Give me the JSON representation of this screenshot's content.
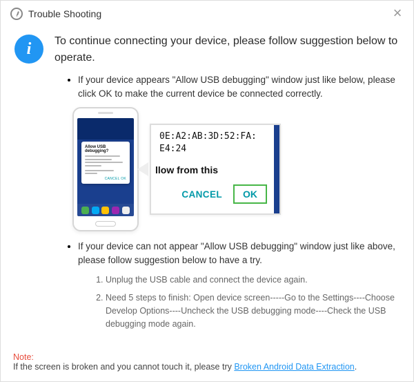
{
  "window": {
    "title": "Trouble Shooting",
    "info_glyph": "i"
  },
  "headline": "To continue connecting your device, please follow suggestion below to operate.",
  "bullet1": "If your device appears \"Allow USB debugging\" window just like below, please click OK to make the current device  be connected correctly.",
  "bullet2": "If your device can not appear \"Allow USB debugging\" window just like above, please follow suggestion below to have a try.",
  "phone_dialog": {
    "title": "Allow USB debugging?",
    "buttons": "CANCEL    OK"
  },
  "zoom": {
    "mac_line1": "0E:A2:AB:3D:52:FA:",
    "mac_line2": "E4:24",
    "allow_from": "llow from this",
    "cancel": "CANCEL",
    "ok": "OK"
  },
  "steps": [
    "Unplug the USB cable and connect the device again.",
    "Need 5 steps to finish: Open device screen-----Go to the Settings----Choose Develop Options----Uncheck the USB debugging mode----Check the USB debugging mode again."
  ],
  "note": {
    "label": "Note:",
    "text": "If the screen is broken and you cannot touch it, please try ",
    "link": "Broken Android Data Extraction",
    "suffix": "."
  }
}
